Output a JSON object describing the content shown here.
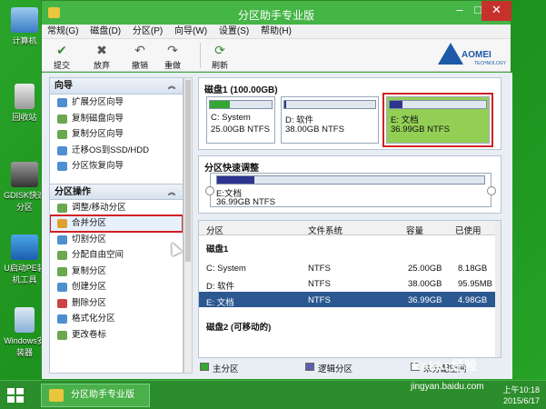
{
  "window": {
    "title": "分区助手专业版"
  },
  "desktop": {
    "icons": [
      "计算机",
      "回收站",
      "GDISK快速分区",
      "U启动PE装机工具",
      "Windows安装器"
    ]
  },
  "menu": [
    "常规(G)",
    "磁盘(D)",
    "分区(P)",
    "向导(W)",
    "设置(S)",
    "帮助(H)"
  ],
  "toolbar": {
    "buttons": [
      "提交",
      "放弃",
      "撤销",
      "重做",
      "刷新"
    ],
    "logo": "AOMEI",
    "logo_sub": "TECHNOLOGY"
  },
  "wizard": {
    "title": "向导",
    "items": [
      "扩展分区向导",
      "复制磁盘向导",
      "复制分区向导",
      "迁移OS到SSD/HDD",
      "分区恢复向导"
    ]
  },
  "partition_ops": {
    "title": "分区操作",
    "items": [
      "调整/移动分区",
      "合并分区",
      "切割分区",
      "分配自由空间",
      "复制分区",
      "创建分区",
      "删除分区",
      "格式化分区",
      "更改卷标"
    ]
  },
  "disk1": {
    "header": "磁盘1 (100.00GB)",
    "partitions": [
      {
        "name": "C: System",
        "info": "25.00GB NTFS",
        "used_fraction": 0.33,
        "color": "#34a634"
      },
      {
        "name": "D: 软件",
        "info": "38.00GB NTFS",
        "used_fraction": 0.02,
        "color": "#2d3590"
      },
      {
        "name": "E: 文档",
        "info": "36.99GB NTFS",
        "used_fraction": 0.13,
        "color": "#2d3590"
      }
    ]
  },
  "quick_adjust": {
    "title": "分区快速调整",
    "name": "E:文档",
    "info": "36.99GB NTFS",
    "used_fraction": 0.14
  },
  "table": {
    "headers": [
      "分区",
      "文件系统",
      "容量",
      "已使用"
    ],
    "group1": "磁盘1",
    "rows": [
      {
        "partition": "C: System",
        "fs": "NTFS",
        "capacity": "25.00GB",
        "used": "8.18GB"
      },
      {
        "partition": "D: 软件",
        "fs": "NTFS",
        "capacity": "38.00GB",
        "used": "95.95MB"
      },
      {
        "partition": "E: 文档",
        "fs": "NTFS",
        "capacity": "36.99GB",
        "used": "4.98GB"
      }
    ],
    "group2": "磁盘2 (可移动的)"
  },
  "legend": {
    "items": [
      "主分区",
      "逻辑分区",
      "未分配空间"
    ],
    "colors": [
      "#34a634",
      "#5b60b0",
      "#f4f4f4"
    ]
  },
  "taskbar": {
    "app": "分区助手专业版",
    "time": "上午10:18",
    "date": "2015/6/17"
  },
  "watermark": {
    "brand": "Baidu 经验",
    "url": "jingyan.baidu.com"
  }
}
